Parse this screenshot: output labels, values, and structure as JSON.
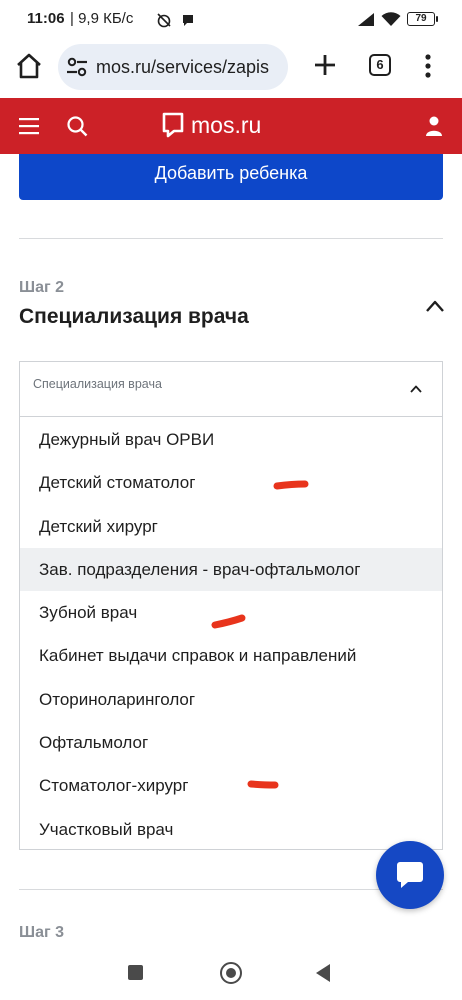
{
  "status_bar": {
    "time": "11:06",
    "network_speed": "| 9,9 КБ/с",
    "battery": "79",
    "icons": [
      "alarm-off-icon",
      "chat-bubble-icon",
      "signal-icon",
      "wifi-icon",
      "battery-icon"
    ]
  },
  "browser": {
    "url": "mos.ru/services/zapis",
    "tab_count": "6",
    "icons": [
      "home-icon",
      "site-settings-icon",
      "new-tab-icon",
      "tabs-icon",
      "more-icon"
    ]
  },
  "site_header": {
    "logo_text": "mos.ru",
    "brand_color": "#cc2127",
    "icons": [
      "menu-icon",
      "search-icon",
      "logo-icon",
      "user-icon"
    ]
  },
  "main": {
    "add_child_label": "Добавить ребенка",
    "accent_color": "#0d47c9",
    "step2": {
      "label": "Шаг 2",
      "title": "Специализация врача"
    },
    "specialization_select": {
      "placeholder": "Специализация врача",
      "expanded": true,
      "options": [
        "Дежурный врач ОРВИ",
        "Детский стоматолог",
        "Детский хирург",
        "Зав. подразделения - врач-офтальмолог",
        "Зубной врач",
        "Кабинет выдачи справок и направлений",
        "Оториноларинголог",
        "Офтальмолог",
        "Стоматолог-хирург",
        "Участковый врач"
      ],
      "highlighted_option": "Зав. подразделения - врач-офтальмолог"
    },
    "step3": {
      "label": "Шаг 3"
    }
  },
  "annotation_color": "#e8341c",
  "chat_button": {
    "icon": "chat-icon",
    "color": "#1548c4"
  },
  "nav_bar": {
    "icons": [
      "recents-icon",
      "home-icon",
      "back-icon"
    ]
  }
}
